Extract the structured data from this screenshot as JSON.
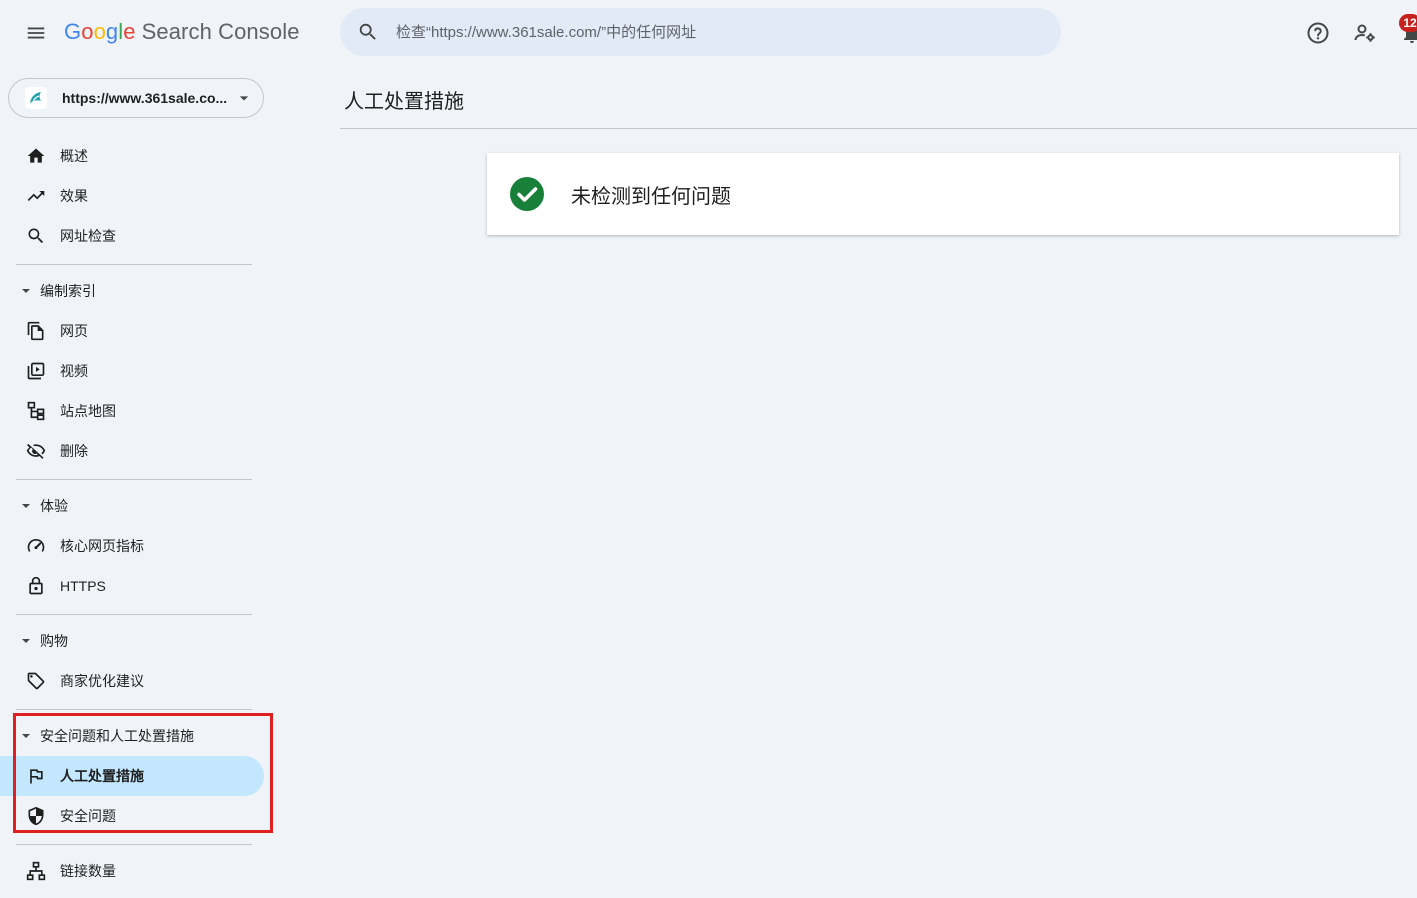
{
  "header": {
    "logo_google": [
      "G",
      "o",
      "o",
      "g",
      "l",
      "e"
    ],
    "logo_product": "Search Console",
    "search_placeholder": "检查“https://www.361sale.com/”中的任何网址",
    "notification_count": "12"
  },
  "property": {
    "label": "https://www.361sale.co..."
  },
  "sidebar": {
    "items": [
      {
        "label": "概述",
        "icon": "home-icon"
      },
      {
        "label": "效果",
        "icon": "trending-up-icon"
      },
      {
        "label": "网址检查",
        "icon": "search-icon"
      }
    ],
    "sections": [
      {
        "title": "编制索引",
        "items": [
          {
            "label": "网页",
            "icon": "pages-icon"
          },
          {
            "label": "视频",
            "icon": "video-icon"
          },
          {
            "label": "站点地图",
            "icon": "sitemap-icon"
          },
          {
            "label": "删除",
            "icon": "removals-icon"
          }
        ]
      },
      {
        "title": "体验",
        "items": [
          {
            "label": "核心网页指标",
            "icon": "speedometer-icon"
          },
          {
            "label": "HTTPS",
            "icon": "lock-icon"
          }
        ]
      },
      {
        "title": "购物",
        "items": [
          {
            "label": "商家优化建议",
            "icon": "tag-icon"
          }
        ]
      },
      {
        "title": "安全问题和人工处置措施",
        "items": [
          {
            "label": "人工处置措施",
            "icon": "flag-icon",
            "active": true
          },
          {
            "label": "安全问题",
            "icon": "shield-icon"
          }
        ]
      }
    ],
    "bottom_items": [
      {
        "label": "链接数量",
        "icon": "links-icon"
      }
    ]
  },
  "main": {
    "title": "人工处置措施",
    "status_message": "未检测到任何问题"
  },
  "colors": {
    "background": "#f0f4f9",
    "active_nav": "#c2e7ff",
    "success": "#188038",
    "highlight_border": "#e02020",
    "badge": "#c5221f"
  }
}
